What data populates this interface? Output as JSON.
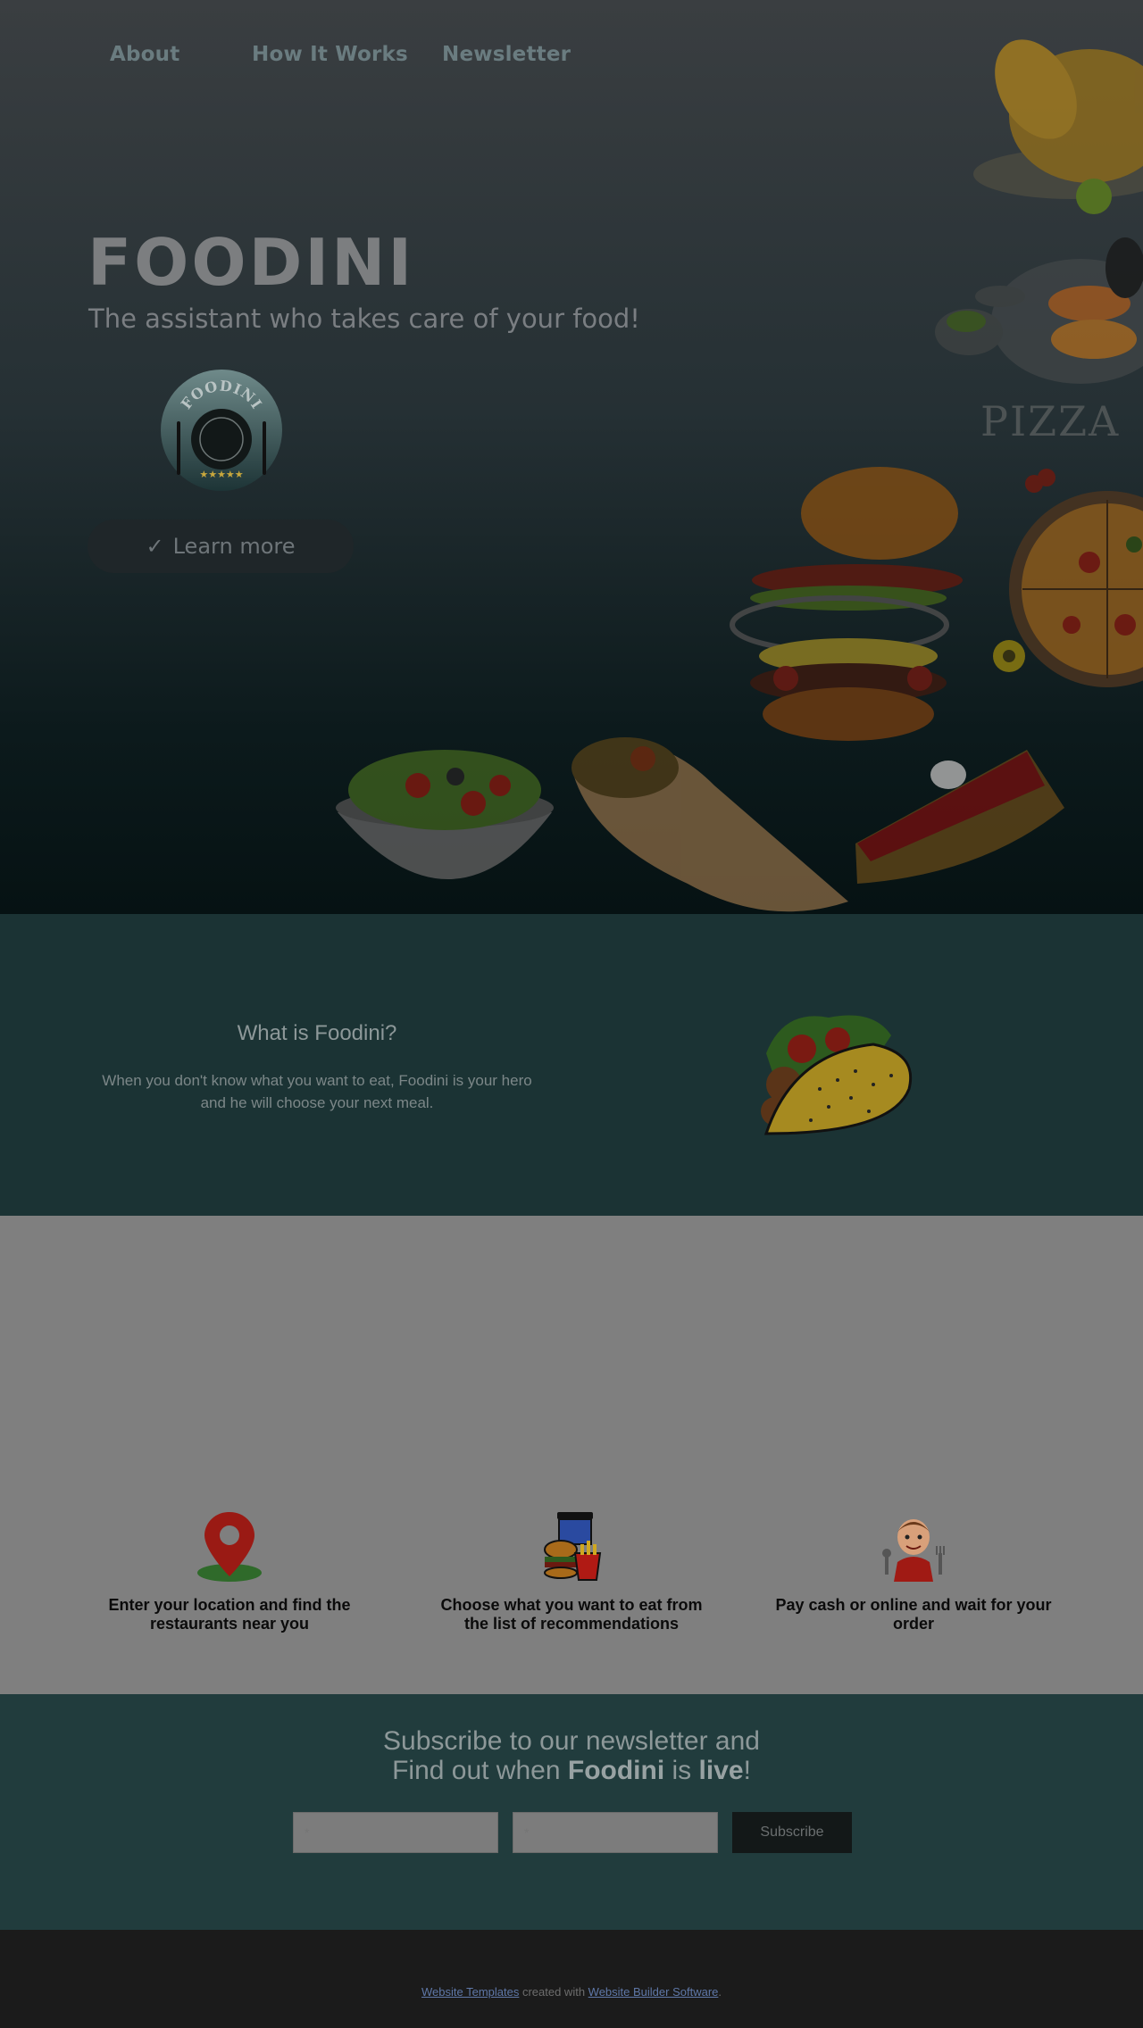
{
  "nav": {
    "items": [
      "About",
      "How It Works",
      "Newsletter"
    ]
  },
  "hero": {
    "title": "FOODINI",
    "tagline": "The assistant who takes care of your food!",
    "logo_text": "FOODINI",
    "button_label": "Learn more",
    "pizza_text": "PIZZA"
  },
  "what": {
    "title": "What is Foodini?",
    "text": "When you don't know what you want to eat, Foodini is your hero and he will choose your next meal."
  },
  "steps": [
    {
      "icon": "map-pin-icon",
      "label": "Enter your location and find the restaurants near you"
    },
    {
      "icon": "fast-food-icon",
      "label": "Choose what you want to eat from the list of recommendations"
    },
    {
      "icon": "chef-icon",
      "label": "Pay cash or online and wait for your order"
    }
  ],
  "newsletter": {
    "line1": "Subscribe to our newsletter and",
    "line2_pre": "Find out when ",
    "line2_brand": "Foodini",
    "line2_mid": " is ",
    "line2_live": "live",
    "line2_end": "!",
    "field1_placeholder": "*",
    "field2_placeholder": "*",
    "button_label": "Subscribe"
  },
  "footer": {
    "link1": "Website Templates",
    "middle": " created with ",
    "link2": "Website Builder Software",
    "end": "."
  },
  "colors": {
    "hero_top": "#3a3e41",
    "what_bg": "#1b3334",
    "steps_bg": "#7f7f7f",
    "news_bg": "#213c3d",
    "footer_bg": "#1b1b1b"
  }
}
